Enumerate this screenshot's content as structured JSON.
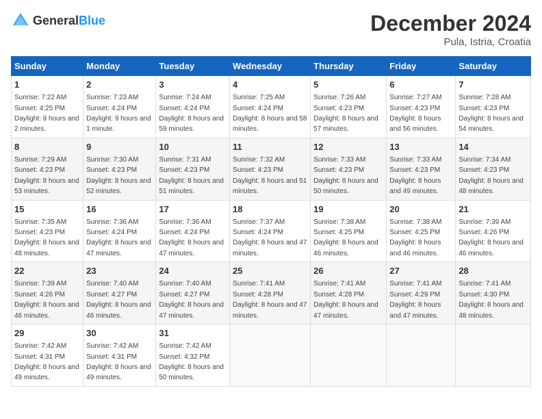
{
  "header": {
    "logo_general": "General",
    "logo_blue": "Blue",
    "title": "December 2024",
    "subtitle": "Pula, Istria, Croatia"
  },
  "days_of_week": [
    "Sunday",
    "Monday",
    "Tuesday",
    "Wednesday",
    "Thursday",
    "Friday",
    "Saturday"
  ],
  "weeks": [
    [
      {
        "day": "1",
        "sunrise": "Sunrise: 7:22 AM",
        "sunset": "Sunset: 4:25 PM",
        "daylight": "Daylight: 9 hours and 2 minutes."
      },
      {
        "day": "2",
        "sunrise": "Sunrise: 7:23 AM",
        "sunset": "Sunset: 4:24 PM",
        "daylight": "Daylight: 9 hours and 1 minute."
      },
      {
        "day": "3",
        "sunrise": "Sunrise: 7:24 AM",
        "sunset": "Sunset: 4:24 PM",
        "daylight": "Daylight: 8 hours and 59 minutes."
      },
      {
        "day": "4",
        "sunrise": "Sunrise: 7:25 AM",
        "sunset": "Sunset: 4:24 PM",
        "daylight": "Daylight: 8 hours and 58 minutes."
      },
      {
        "day": "5",
        "sunrise": "Sunrise: 7:26 AM",
        "sunset": "Sunset: 4:23 PM",
        "daylight": "Daylight: 8 hours and 57 minutes."
      },
      {
        "day": "6",
        "sunrise": "Sunrise: 7:27 AM",
        "sunset": "Sunset: 4:23 PM",
        "daylight": "Daylight: 8 hours and 56 minutes."
      },
      {
        "day": "7",
        "sunrise": "Sunrise: 7:28 AM",
        "sunset": "Sunset: 4:23 PM",
        "daylight": "Daylight: 8 hours and 54 minutes."
      }
    ],
    [
      {
        "day": "8",
        "sunrise": "Sunrise: 7:29 AM",
        "sunset": "Sunset: 4:23 PM",
        "daylight": "Daylight: 8 hours and 53 minutes."
      },
      {
        "day": "9",
        "sunrise": "Sunrise: 7:30 AM",
        "sunset": "Sunset: 4:23 PM",
        "daylight": "Daylight: 8 hours and 52 minutes."
      },
      {
        "day": "10",
        "sunrise": "Sunrise: 7:31 AM",
        "sunset": "Sunset: 4:23 PM",
        "daylight": "Daylight: 8 hours and 51 minutes."
      },
      {
        "day": "11",
        "sunrise": "Sunrise: 7:32 AM",
        "sunset": "Sunset: 4:23 PM",
        "daylight": "Daylight: 8 hours and 51 minutes."
      },
      {
        "day": "12",
        "sunrise": "Sunrise: 7:33 AM",
        "sunset": "Sunset: 4:23 PM",
        "daylight": "Daylight: 8 hours and 50 minutes."
      },
      {
        "day": "13",
        "sunrise": "Sunrise: 7:33 AM",
        "sunset": "Sunset: 4:23 PM",
        "daylight": "Daylight: 8 hours and 49 minutes."
      },
      {
        "day": "14",
        "sunrise": "Sunrise: 7:34 AM",
        "sunset": "Sunset: 4:23 PM",
        "daylight": "Daylight: 8 hours and 48 minutes."
      }
    ],
    [
      {
        "day": "15",
        "sunrise": "Sunrise: 7:35 AM",
        "sunset": "Sunset: 4:23 PM",
        "daylight": "Daylight: 8 hours and 48 minutes."
      },
      {
        "day": "16",
        "sunrise": "Sunrise: 7:36 AM",
        "sunset": "Sunset: 4:24 PM",
        "daylight": "Daylight: 8 hours and 47 minutes."
      },
      {
        "day": "17",
        "sunrise": "Sunrise: 7:36 AM",
        "sunset": "Sunset: 4:24 PM",
        "daylight": "Daylight: 8 hours and 47 minutes."
      },
      {
        "day": "18",
        "sunrise": "Sunrise: 7:37 AM",
        "sunset": "Sunset: 4:24 PM",
        "daylight": "Daylight: 8 hours and 47 minutes."
      },
      {
        "day": "19",
        "sunrise": "Sunrise: 7:38 AM",
        "sunset": "Sunset: 4:25 PM",
        "daylight": "Daylight: 8 hours and 46 minutes."
      },
      {
        "day": "20",
        "sunrise": "Sunrise: 7:38 AM",
        "sunset": "Sunset: 4:25 PM",
        "daylight": "Daylight: 8 hours and 46 minutes."
      },
      {
        "day": "21",
        "sunrise": "Sunrise: 7:39 AM",
        "sunset": "Sunset: 4:26 PM",
        "daylight": "Daylight: 8 hours and 46 minutes."
      }
    ],
    [
      {
        "day": "22",
        "sunrise": "Sunrise: 7:39 AM",
        "sunset": "Sunset: 4:26 PM",
        "daylight": "Daylight: 8 hours and 46 minutes."
      },
      {
        "day": "23",
        "sunrise": "Sunrise: 7:40 AM",
        "sunset": "Sunset: 4:27 PM",
        "daylight": "Daylight: 8 hours and 46 minutes."
      },
      {
        "day": "24",
        "sunrise": "Sunrise: 7:40 AM",
        "sunset": "Sunset: 4:27 PM",
        "daylight": "Daylight: 8 hours and 47 minutes."
      },
      {
        "day": "25",
        "sunrise": "Sunrise: 7:41 AM",
        "sunset": "Sunset: 4:28 PM",
        "daylight": "Daylight: 8 hours and 47 minutes."
      },
      {
        "day": "26",
        "sunrise": "Sunrise: 7:41 AM",
        "sunset": "Sunset: 4:28 PM",
        "daylight": "Daylight: 8 hours and 47 minutes."
      },
      {
        "day": "27",
        "sunrise": "Sunrise: 7:41 AM",
        "sunset": "Sunset: 4:29 PM",
        "daylight": "Daylight: 8 hours and 47 minutes."
      },
      {
        "day": "28",
        "sunrise": "Sunrise: 7:41 AM",
        "sunset": "Sunset: 4:30 PM",
        "daylight": "Daylight: 8 hours and 48 minutes."
      }
    ],
    [
      {
        "day": "29",
        "sunrise": "Sunrise: 7:42 AM",
        "sunset": "Sunset: 4:31 PM",
        "daylight": "Daylight: 8 hours and 49 minutes."
      },
      {
        "day": "30",
        "sunrise": "Sunrise: 7:42 AM",
        "sunset": "Sunset: 4:31 PM",
        "daylight": "Daylight: 8 hours and 49 minutes."
      },
      {
        "day": "31",
        "sunrise": "Sunrise: 7:42 AM",
        "sunset": "Sunset: 4:32 PM",
        "daylight": "Daylight: 8 hours and 50 minutes."
      },
      null,
      null,
      null,
      null
    ]
  ]
}
